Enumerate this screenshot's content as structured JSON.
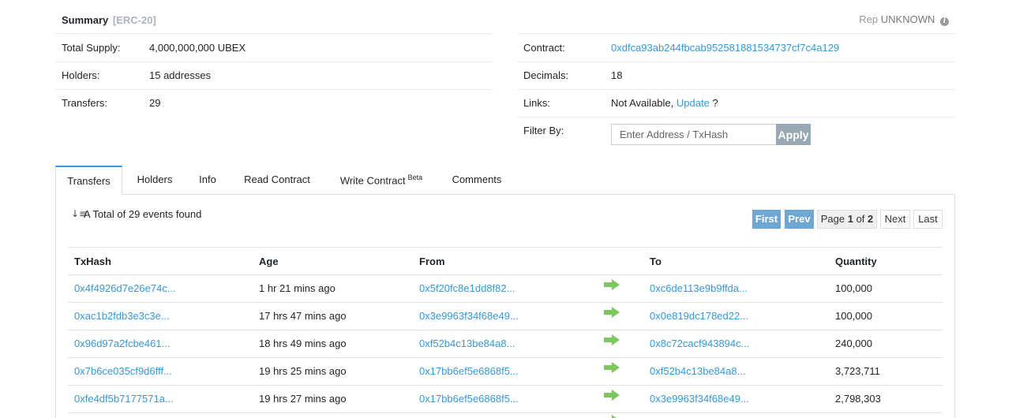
{
  "summary": {
    "title": "Summary",
    "standard": "[ERC-20]",
    "rep_label": "Rep",
    "rep_value": "UNKNOWN",
    "total_supply_label": "Total Supply:",
    "total_supply_value": "4,000,000,000 UBEX",
    "holders_label": "Holders:",
    "holders_value": "15 addresses",
    "transfers_label": "Transfers:",
    "transfers_value": "29",
    "contract_label": "Contract:",
    "contract_value": "0xdfca93ab244fbcab952581881534737cf7c4a129",
    "decimals_label": "Decimals:",
    "decimals_value": "18",
    "links_label": "Links:",
    "links_na": "Not Available,",
    "links_update": "Update",
    "links_q": "?",
    "filter_label": "Filter By:",
    "filter_placeholder": "Enter Address / TxHash",
    "apply_label": "Apply"
  },
  "tabs": [
    {
      "label": "Transfers",
      "active": true
    },
    {
      "label": "Holders"
    },
    {
      "label": "Info"
    },
    {
      "label": "Read Contract"
    },
    {
      "label": "Write Contract",
      "badge": "Beta"
    },
    {
      "label": "Comments"
    }
  ],
  "events": {
    "total_text": "A Total of 29 events found"
  },
  "pagination": {
    "first": "First",
    "prev": "Prev",
    "page_prefix": "Page",
    "page_current": "1",
    "page_of": "of",
    "page_total": "2",
    "next": "Next",
    "last": "Last"
  },
  "table": {
    "headers": {
      "txhash": "TxHash",
      "age": "Age",
      "from": "From",
      "to": "To",
      "quantity": "Quantity"
    },
    "rows": [
      {
        "txhash": "0x4f4926d7e26e74c...",
        "age": "1 hr 21 mins ago",
        "from": "0x5f20fc8e1dd8f82...",
        "to": "0xc6de113e9b9ffda...",
        "quantity": "100,000"
      },
      {
        "txhash": "0xac1b2fdb3e3c3e...",
        "age": "17 hrs 47 mins ago",
        "from": "0x3e9963f34f68e49...",
        "to": "0x0e819dc178ed22...",
        "quantity": "100,000"
      },
      {
        "txhash": "0x96d97a2fcbe461...",
        "age": "18 hrs 49 mins ago",
        "from": "0xf52b4c13be84a8...",
        "to": "0x8c72cacf943894c...",
        "quantity": "240,000"
      },
      {
        "txhash": "0x7b6ce035cf9d6fff...",
        "age": "19 hrs 25 mins ago",
        "from": "0x17bb6ef5e6868f5...",
        "to": "0xf52b4c13be84a8...",
        "quantity": "3,723,711"
      },
      {
        "txhash": "0xfe4df5b7177571a...",
        "age": "19 hrs 27 mins ago",
        "from": "0x17bb6ef5e6868f5...",
        "to": "0x3e9963f34f68e49...",
        "quantity": "2,798,303"
      }
    ]
  },
  "colors": {
    "link": "#3498db",
    "arrow": "#7cc85c",
    "pager_blue": "#6fa7d3",
    "apply_bg": "#99a9b3"
  },
  "icons": {
    "info": "info-icon",
    "sort": "sort-icon",
    "arrow": "arrow-right-icon"
  }
}
